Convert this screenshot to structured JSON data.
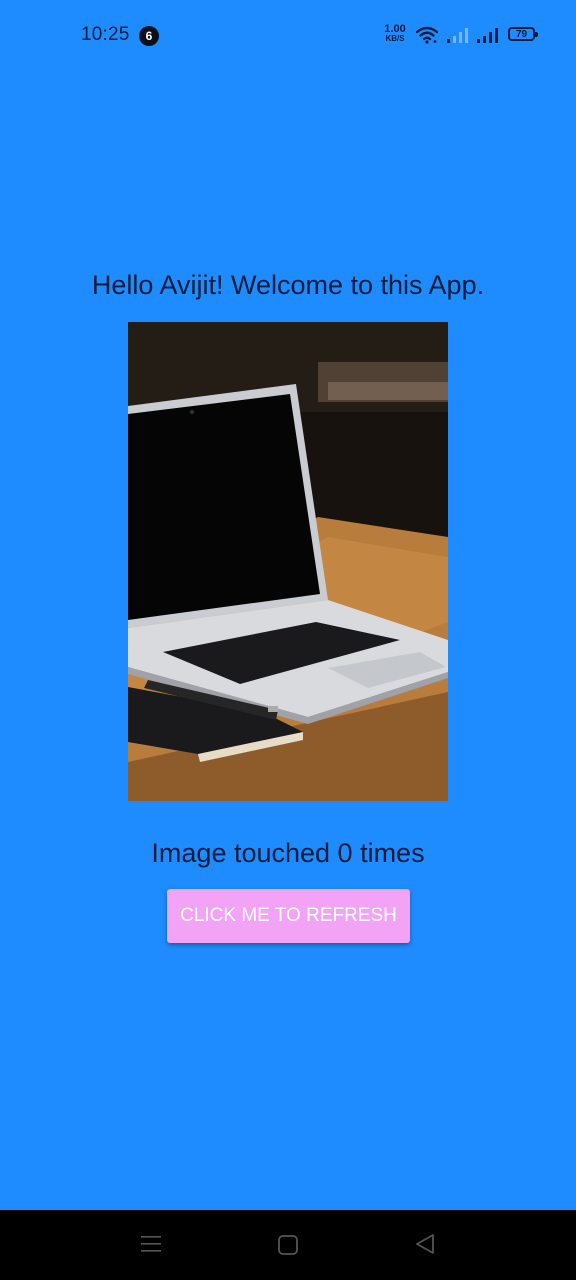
{
  "status_bar": {
    "time": "10:25",
    "notification_count": "6",
    "net_speed_value": "1.00",
    "net_speed_unit": "KB/S",
    "battery_level": "79"
  },
  "main": {
    "welcome_text": "Hello Avijit! Welcome to this App.",
    "image_subject": "laptop-on-wooden-desk",
    "touch_count_text": "Image touched 0 times",
    "refresh_button_label": "CLICK ME TO REFRESH"
  },
  "colors": {
    "background": "#1e8cff",
    "button": "#f2a3f5",
    "text": "#0b1b3a"
  },
  "nav_bar": {
    "icons": [
      "menu-icon",
      "home-icon",
      "back-icon"
    ]
  }
}
